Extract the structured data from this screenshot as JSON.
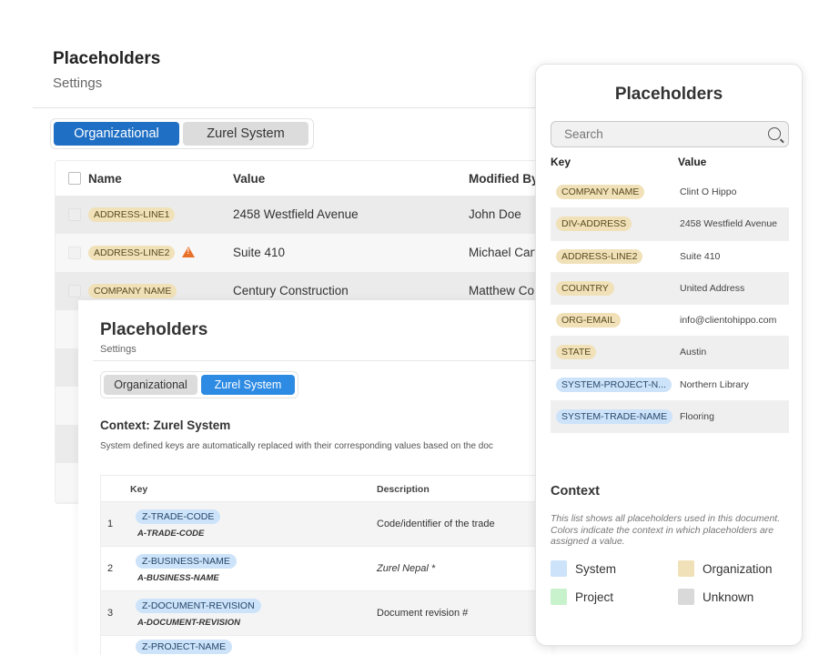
{
  "background": {
    "title": "Placeholders",
    "subtitle": "Settings",
    "tabs": [
      "Organizational",
      "Zurel System"
    ],
    "columns": [
      "Name",
      "Value",
      "Modified By"
    ],
    "rows": [
      {
        "name": "ADDRESS-LINE1",
        "value": "2458 Westfield Avenue",
        "modified": "John Doe"
      },
      {
        "name": "ADDRESS-LINE2",
        "value": "Suite 410",
        "modified": "Michael Cart"
      },
      {
        "name": "COMPANY NAME",
        "value": "Century Construction",
        "modified": "Matthew Co"
      }
    ]
  },
  "zurel": {
    "title": "Placeholders",
    "subtitle": "Settings",
    "tabs": [
      "Organizational",
      "Zurel System"
    ],
    "context_title": "Context: Zurel System",
    "context_note": "System defined keys are automatically replaced with their corresponding values based on the doc",
    "columns": [
      "Key",
      "Description"
    ],
    "rows": [
      {
        "num": "1",
        "key": "Z-TRADE-CODE",
        "alias": "A-TRADE-CODE",
        "desc": "Code/identifier of the trade"
      },
      {
        "num": "2",
        "key": "Z-BUSINESS-NAME",
        "alias": "A-BUSINESS-NAME",
        "desc": "Zurel Nepal *"
      },
      {
        "num": "3",
        "key": "Z-DOCUMENT-REVISION",
        "alias": "A-DOCUMENT-REVISION",
        "desc": "Document revision #"
      },
      {
        "num": "",
        "key": "Z-PROJECT-NAME",
        "alias": "",
        "desc": ""
      }
    ]
  },
  "panel": {
    "title": "Placeholders",
    "search_placeholder": "Search",
    "columns": [
      "Key",
      "Value"
    ],
    "rows": [
      {
        "key": "COMPANY NAME",
        "context": "organization",
        "value": "Clint O Hippo"
      },
      {
        "key": "DIV-ADDRESS",
        "context": "organization",
        "value": "2458 Westfield Avenue"
      },
      {
        "key": "ADDRESS-LINE2",
        "context": "organization",
        "value": "Suite 410"
      },
      {
        "key": "COUNTRY",
        "context": "organization",
        "value": "United Address"
      },
      {
        "key": "ORG-EMAIL",
        "context": "organization",
        "value": "info@clientohippo.com"
      },
      {
        "key": "STATE",
        "context": "organization",
        "value": "Austin"
      },
      {
        "key": "SYSTEM-PROJECT-N...",
        "context": "system",
        "value": "Northern Library"
      },
      {
        "key": "SYSTEM-TRADE-NAME",
        "context": "system",
        "value": "Flooring"
      }
    ],
    "context_title": "Context",
    "context_note": "This list shows all placeholders used in this document. Colors indicate the context in which placeholders are assigned a value.",
    "legend": [
      {
        "label": "System",
        "color": "#cde3f9"
      },
      {
        "label": "Organization",
        "color": "#f1e1b8"
      },
      {
        "label": "Project",
        "color": "#c7f2cc"
      },
      {
        "label": "Unknown",
        "color": "#d9d9d9"
      }
    ]
  },
  "colors": {
    "primary": "#1f6fc4",
    "primary_light": "#2e8be3",
    "organization": "#f1e1b8",
    "system": "#cde3f9",
    "warning": "#e8702a"
  }
}
